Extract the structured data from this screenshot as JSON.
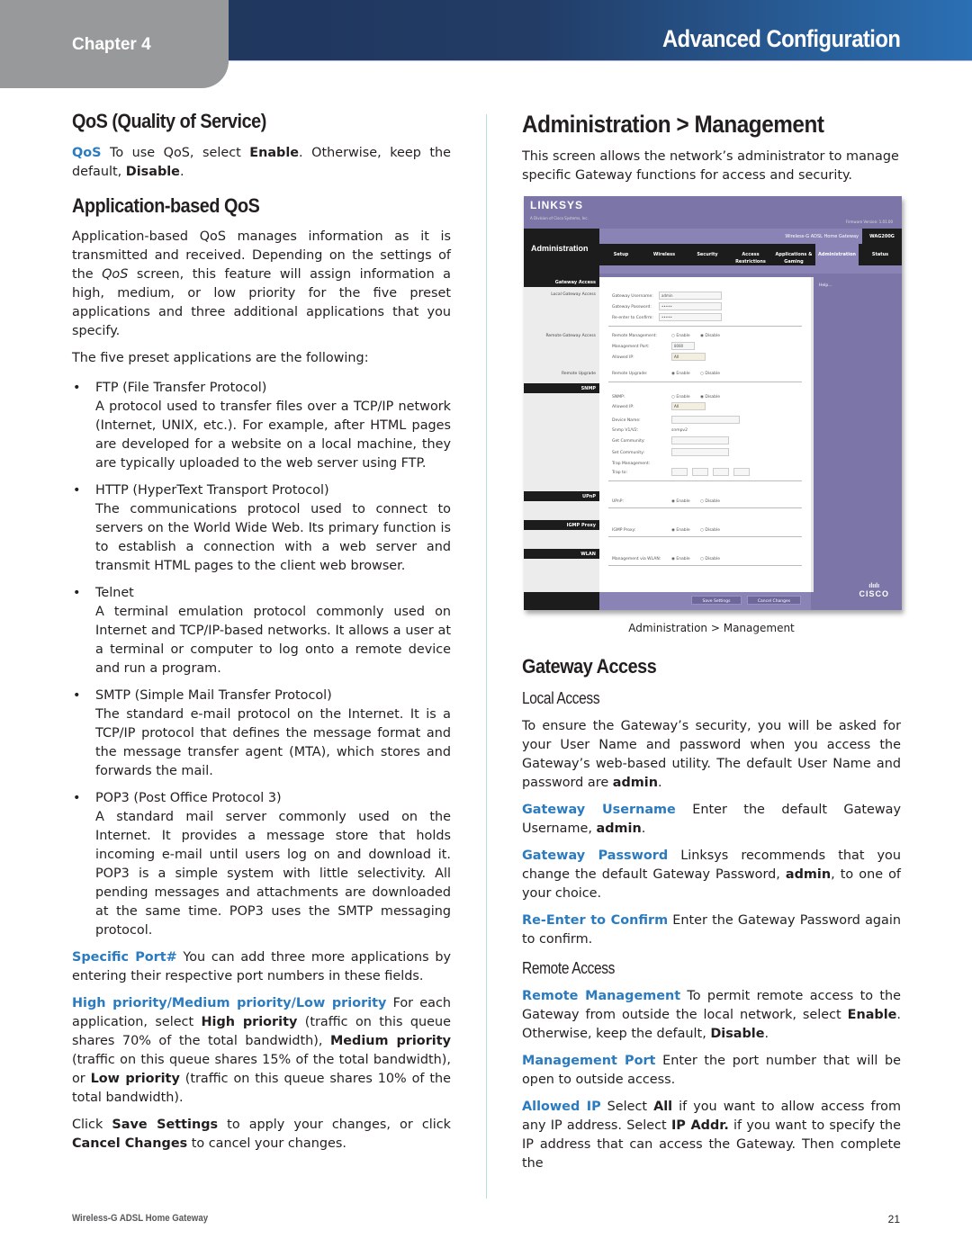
{
  "header": {
    "chapter": "Chapter 4",
    "section": "Advanced Configuration",
    "colors": {
      "bar_dark": "#1e3358",
      "bar_light": "#2b70b4",
      "chapter_tab": "#98999b",
      "accent": "#2a7bc0"
    }
  },
  "left": {
    "qos_heading": "QoS (Quality of Service)",
    "qos_para": {
      "term": "QoS",
      "t1": " To use QoS, select ",
      "b1": "Enable",
      "t2": ". Otherwise, keep the default, ",
      "b2": "Disable",
      "t3": "."
    },
    "app_heading": "Application-based QoS",
    "app_para": {
      "t1": "Application-based QoS manages information as it is transmitted and received. Depending on the settings of the ",
      "i1": "QoS",
      "t2": " screen, this feature will assign information a high, medium, or low priority for the five preset applications and three additional applications that you specify."
    },
    "preset_intro": "The five preset applications are the following:",
    "bullets": [
      {
        "title": "FTP (File Transfer Protocol)",
        "body": "A protocol used to transfer files over a TCP/IP network (Internet, UNIX, etc.). For example, after HTML pages are developed for a website on a local machine, they are typically uploaded to the web server using FTP."
      },
      {
        "title": "HTTP (HyperText Transport Protocol)",
        "body": "The communications protocol used to connect to servers on the World Wide Web. Its primary function is to establish a connection with a web server and transmit HTML pages to the client web browser."
      },
      {
        "title": "Telnet",
        "body": "A terminal emulation protocol commonly used on Internet and TCP/IP-based networks. It allows a user at a terminal or computer to log onto a remote device and run a program."
      },
      {
        "title": "SMTP (Simple Mail Transfer Protocol)",
        "body": "The standard e-mail protocol on the Internet. It is a TCP/IP protocol that defines the message format and the message transfer agent (MTA), which stores and forwards the mail."
      },
      {
        "title": "POP3 (Post Office Protocol 3)",
        "body": "A standard mail server commonly used on the Internet. It provides a message store that holds incoming e-mail until users log on and download it. POP3 is a simple system with little selectivity. All pending messages and attachments are downloaded at the same time. POP3 uses the SMTP messaging protocol."
      }
    ],
    "specific_port": {
      "term": "Specific Port#",
      "text": "  You can add three more applications by entering their respective port numbers in these fields."
    },
    "priority": {
      "term": "High priority/Medium priority/Low priority",
      "t1": " For each application, select ",
      "b1": "High priority",
      "t2": " (traffic on this queue shares 70% of the total bandwidth), ",
      "b2": "Medium priority",
      "t3": " (traffic on this queue shares 15% of the total bandwidth), or ",
      "b3": "Low priority",
      "t4": " (traffic on this queue shares 10% of the total bandwidth)."
    },
    "save_para": {
      "t1": "Click ",
      "b1": "Save Settings",
      "t2": " to apply your changes, or click ",
      "b2": "Cancel Changes",
      "t3": " to cancel your changes."
    }
  },
  "right": {
    "admin_heading": "Administration > Management",
    "admin_para": "This screen allows the network’s administrator to manage specific Gateway functions for access and security.",
    "screenshot": {
      "logo": "LINKSYS",
      "logo_sub": "A Division of Cisco Systems, Inc.",
      "firmware": "Firmware Version: 1.01.00",
      "page_title": "Administration",
      "model_name": "Wireless-G ADSL Home Gateway",
      "model_id": "WAG200G",
      "nav_tabs": [
        "Setup",
        "Wireless",
        "Security",
        "Access Restrictions",
        "Applications & Gaming",
        "Administration",
        "Status"
      ],
      "sections": [
        "Gateway Access",
        "SNMP",
        "UPnP",
        "IGMP Proxy",
        "WLAN"
      ],
      "labels": {
        "local": "Local Gateway Access",
        "remote": "Remote Gateway Access",
        "upgrade": "Remote Upgrade"
      },
      "fields": {
        "username_label": "Gateway Username:",
        "username_value": "admin",
        "password_label": "Gateway Password:",
        "password_value": "•••••",
        "confirm_label": "Re-enter to Confirm:",
        "confirm_value": "•••••",
        "remote_mgmt": "Remote Management:",
        "mgmt_port": "Management Port:",
        "mgmt_port_value": "8080",
        "allowed_ip": "Allowed IP:",
        "allowed_ip_value": "All",
        "remote_upgrade": "Remote Upgrade:",
        "snmp": "SNMP:",
        "snmp_allowed_ip": "Allowed IP:",
        "snmp_allowed_ip_value": "All",
        "device_name": "Device Name:",
        "snmp_v1v2": "Snmp V1/V2:",
        "snmp_v1v2_value": "snmpv2",
        "get_community": "Get Community:",
        "set_community": "Set Community:",
        "trap_mgmt": "Trap Management:",
        "trap_to": "Trap to:",
        "upnp": "UPnP:",
        "igmp": "IGMP Proxy:",
        "wlan": "Management via WLAN:",
        "enable": "Enable",
        "disable": "Disable"
      },
      "help": "Help...",
      "save_button": "Save Settings",
      "cancel_button": "Cancel Changes",
      "cisco": "CISCO"
    },
    "caption": "Administration > Management",
    "gateway_heading": "Gateway Access",
    "local_heading": "Local Access",
    "local_para": {
      "t1": "To ensure the Gateway’s security, you will be asked for your User Name and password when you access the Gateway’s web-based utility. The default User Name and password are ",
      "b1": "admin",
      "t2": "."
    },
    "gw_user": {
      "term": "Gateway Username",
      "t1": " Enter the default Gateway Username, ",
      "b1": "admin",
      "t2": "."
    },
    "gw_pass": {
      "term": "Gateway Password",
      "t1": " Linksys recommends that you change the default Gateway Password, ",
      "b1": "admin",
      "t2": ", to one of your choice."
    },
    "reenter": {
      "term": "Re-Enter to Confirm",
      "t1": "  Enter the Gateway Password again to confirm."
    },
    "remote_heading": "Remote Access",
    "remote_mgmt": {
      "term": "Remote Management",
      "t1": "  To permit remote access to the Gateway from outside the local network, select ",
      "b1": "Enable",
      "t2": ". Otherwise, keep the default, ",
      "b2": "Disable",
      "t3": "."
    },
    "mgmt_port": {
      "term": "Management Port",
      "t1": "  Enter the port number that will be open to outside access."
    },
    "allowed_ip": {
      "term": "Allowed IP",
      "t1": "  Select ",
      "b1": "All",
      "t2": " if you want to allow access from any IP address. Select ",
      "b2": "IP Addr.",
      "t3": " if you want to specify the IP address that can access the Gateway. Then complete the"
    }
  },
  "footer": {
    "product": "Wireless-G ADSL Home Gateway",
    "page": "21"
  }
}
